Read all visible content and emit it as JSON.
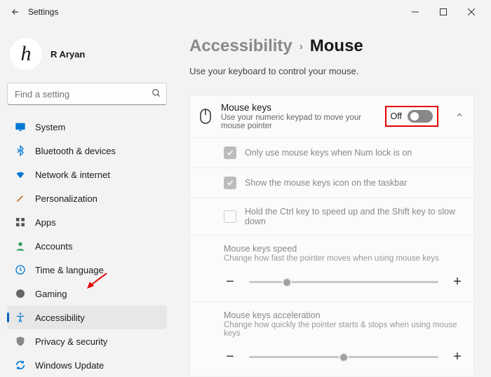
{
  "titlebar": {
    "title": "Settings"
  },
  "user": {
    "name": "R Aryan",
    "avatar_glyph": "h"
  },
  "search": {
    "placeholder": "Find a setting"
  },
  "nav": [
    {
      "label": "System",
      "key": "system"
    },
    {
      "label": "Bluetooth & devices",
      "key": "bluetooth"
    },
    {
      "label": "Network & internet",
      "key": "network"
    },
    {
      "label": "Personalization",
      "key": "personalization"
    },
    {
      "label": "Apps",
      "key": "apps"
    },
    {
      "label": "Accounts",
      "key": "accounts"
    },
    {
      "label": "Time & language",
      "key": "time"
    },
    {
      "label": "Gaming",
      "key": "gaming"
    },
    {
      "label": "Accessibility",
      "key": "accessibility"
    },
    {
      "label": "Privacy & security",
      "key": "privacy"
    },
    {
      "label": "Windows Update",
      "key": "update"
    }
  ],
  "crumbs": {
    "parent": "Accessibility",
    "current": "Mouse"
  },
  "page": {
    "description": "Use your keyboard to control your mouse.",
    "mousekeys": {
      "title": "Mouse keys",
      "subtitle": "Use your numeric keypad to move your mouse pointer",
      "state_label": "Off"
    },
    "opts": {
      "numlock": "Only use mouse keys when Num lock is on",
      "taskbar": "Show the mouse keys icon on the taskbar",
      "ctrlshift": "Hold the Ctrl key to speed up and the Shift key to slow down"
    },
    "speed": {
      "title": "Mouse keys speed",
      "subtitle": "Change how fast the pointer moves when using mouse keys",
      "value_pct": 20
    },
    "accel": {
      "title": "Mouse keys acceleration",
      "subtitle": "Change how quickly the pointer starts & stops when using mouse keys",
      "value_pct": 50
    }
  }
}
